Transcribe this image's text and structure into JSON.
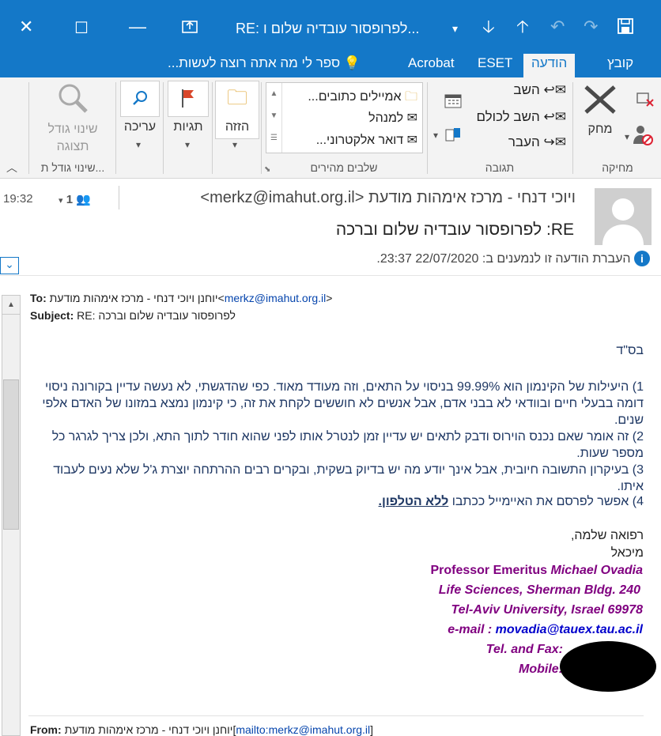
{
  "window": {
    "title": "RE: לפרופסור עובדיה שלום ו...",
    "close_icon": "close-icon",
    "maximize_icon": "maximize-icon",
    "minimize_icon": "minimize-icon",
    "restore_icon": "popout-icon"
  },
  "ribbon_tabs": [
    {
      "label": "קובץ"
    },
    {
      "label": "הודעה"
    },
    {
      "label": "ESET"
    },
    {
      "label": "Acrobat"
    },
    {
      "label": "ספר לי מה אתה רוצה לעשות..."
    }
  ],
  "ribbon": {
    "delete_group": {
      "label": "מחיקה",
      "delete": "מחק"
    },
    "respond_group": {
      "label": "תגובה",
      "reply": "השב",
      "reply_all": "השב לכולם",
      "forward": "העבר"
    },
    "quick_steps": {
      "label": "שלבים מהירים",
      "items": [
        "אמיילים כתובים...",
        "למנהל",
        "דואר אלקטרוני..."
      ]
    },
    "move": {
      "label": "הזזה"
    },
    "tags": {
      "label": "תגיות"
    },
    "editing": {
      "label": "עריכה"
    },
    "zoom": {
      "label": "שינוי גודל תצוגה",
      "group_label": "שינוי גודל ת..."
    }
  },
  "header": {
    "time": "19:32",
    "participants": "1",
    "sender": "ויוכי דנחי - מרכז אימהות מודעת <merkz@imahut.org.il>",
    "subject": "RE: לפרופסור עובדיה שלום וברכה",
    "info": "העברת הודעה זו לנמענים ב: 22/07/2020 23:37."
  },
  "message": {
    "to_label": "To:",
    "to_name": "יוחנן ויוכי דנחי - מרכז אימהות מודעת",
    "to_email": "merkz@imahut.org.il",
    "subject_label": "Subject:",
    "subject": "RE: לפרופסור עובדיה שלום וברכה",
    "bsd": "בס\"ד",
    "p1": "1) היעילות של הקינמון הוא 99.99% בניסוי על התאים, וזה מעודד מאוד. כפי שהדגשתי, לא נעשה עדיין בקורונה ניסוי דומה בבעלי חיים ובוודאי לא בבני אדם, אבל אנשים לא חוששים לקחת את זה, כי קינמון נמצא במזונו של האדם אלפי שנים.",
    "p2": "2) זה אומר שאם נכנס הוירוס ודבק לתאים יש עדיין זמן לנטרל אותו לפני שהוא חודר לתוך התא, ולכן צריך לגרגר כל מספר שעות.",
    "p3": "3) בעיקרון התשובה חיובית, אבל אינך יודע מה יש בדיוק בשקית, ובקרים רבים ההרתחה יוצרת ג'ל שלא נעים לעבוד איתו.",
    "p4_prefix": "4) אפשר לפרסם את האיימייל ככתבו",
    "p4_bold": "ללא הטלפון.",
    "greeting": "רפואה שלמה,",
    "name": "מיכאל",
    "sig1_a": "Professor Emeritus ",
    "sig1_b": "Michael Ovadia",
    "sig2": "Life Sciences, Sherman Bldg. 240",
    "sig3": "Tel-Aviv University, Israel 69978",
    "sig4_label": "e-mail : ",
    "sig4_email": "movadia@tauex.tau.ac.il",
    "sig5": "Tel. and Fax:",
    "sig6": "Mobile:",
    "from_label": "From:",
    "from_name": "יוחנן ויוכי דנחי - מרכז אימהות מודעת",
    "from_link": "mailto:merkz@imahut.org.il"
  },
  "colors": {
    "accent": "#1478c8",
    "signature": "#800080",
    "body_text": "#1f3864"
  }
}
